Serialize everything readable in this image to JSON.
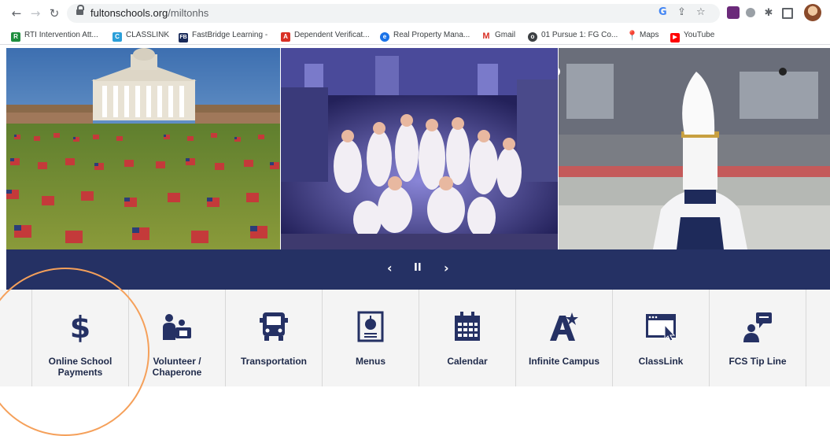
{
  "browser": {
    "url_host": "fultonschools.org",
    "url_path": "/miltonhs",
    "extensions": [
      "google-icon",
      "share-icon",
      "star-icon",
      "extension-a",
      "extension-b",
      "puzzle-icon",
      "side-panel-icon",
      "profile-avatar"
    ]
  },
  "bookmarks": [
    {
      "label": "RTI Intervention Att...",
      "color": "#1e8e3e",
      "glyph": "R"
    },
    {
      "label": "CLASSLINK",
      "color": "#2b9fd9",
      "glyph": "C"
    },
    {
      "label": "FastBridge Learning -",
      "color": "#1a2b5a",
      "glyph": "FB"
    },
    {
      "label": "Dependent Verificat...",
      "color": "#d93025",
      "glyph": "A"
    },
    {
      "label": "Real Property Mana...",
      "color": "#1a73e8",
      "glyph": "e"
    },
    {
      "label": "Gmail",
      "color": "#d93025",
      "glyph": "M"
    },
    {
      "label": "01 Pursue 1: FG Co...",
      "color": "#3c4043",
      "glyph": "o"
    },
    {
      "label": "Maps",
      "color": "#34a853",
      "glyph": "M"
    },
    {
      "label": "YouTube",
      "color": "#ff0000",
      "glyph": "▶"
    }
  ],
  "slider": {
    "prev": "‹",
    "pause": "II",
    "next": "›"
  },
  "tiles": [
    {
      "label": "Online School Payments",
      "icon": "dollar-icon"
    },
    {
      "label": "Volunteer / Chaperone",
      "icon": "volunteer-icon"
    },
    {
      "label": "Transportation",
      "icon": "bus-icon"
    },
    {
      "label": "Menus",
      "icon": "menu-apple-icon"
    },
    {
      "label": "Calendar",
      "icon": "calendar-icon"
    },
    {
      "label": "Infinite Campus",
      "icon": "infinite-campus-icon"
    },
    {
      "label": "ClassLink",
      "icon": "classlink-window-icon"
    },
    {
      "label": "FCS Tip Line",
      "icon": "tip-line-icon"
    }
  ],
  "colors": {
    "navy": "#253164",
    "tile_bg": "#f4f4f4",
    "annotation_circle": "#f5a05a"
  }
}
